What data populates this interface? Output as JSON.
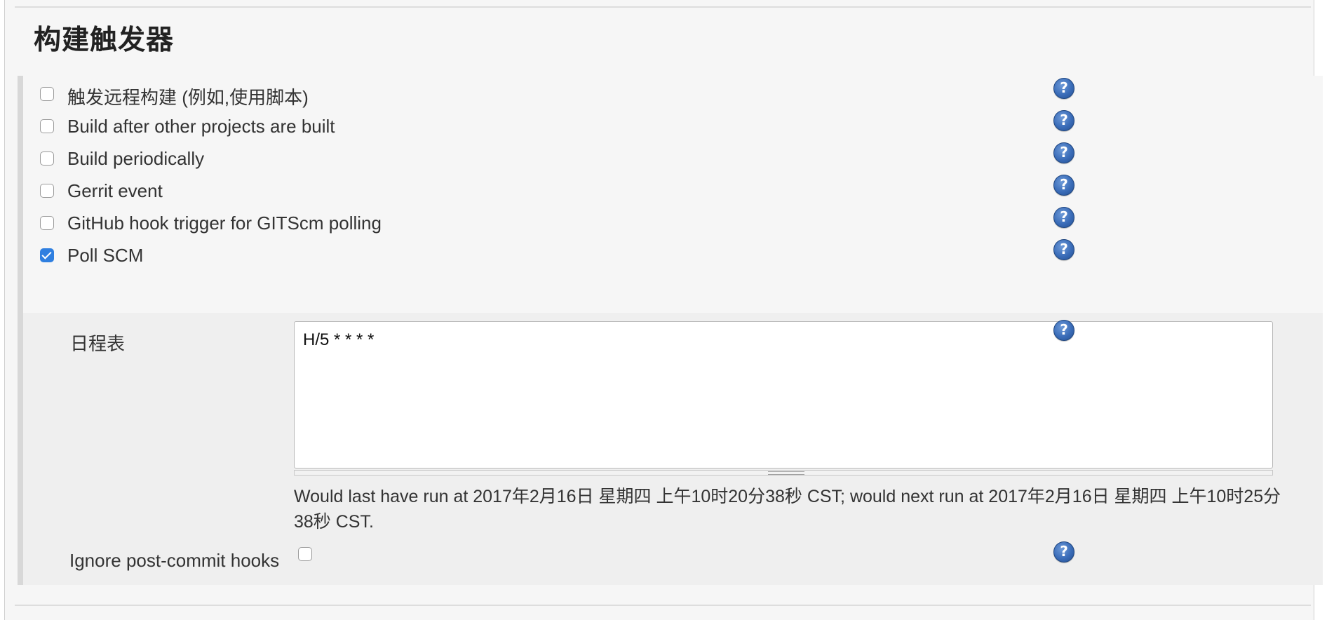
{
  "section": {
    "title": "构建触发器"
  },
  "triggers": [
    {
      "label": "触发远程构建 (例如,使用脚本)",
      "checked": false
    },
    {
      "label": "Build after other projects are built",
      "checked": false
    },
    {
      "label": "Build periodically",
      "checked": false
    },
    {
      "label": "Gerrit event",
      "checked": false
    },
    {
      "label": "GitHub hook trigger for GITScm polling",
      "checked": false
    },
    {
      "label": "Poll SCM",
      "checked": true
    }
  ],
  "poll_scm": {
    "schedule_label": "日程表",
    "schedule_value": "H/5 * * * *",
    "schedule_info": "Would last have run at 2017年2月16日 星期四 上午10时20分38秒 CST; would next run at 2017年2月16日 星期四 上午10时25分38秒 CST.",
    "ignore_hooks_label": "Ignore post-commit hooks",
    "ignore_hooks_checked": false
  },
  "help_icon_glyph": "?",
  "colors": {
    "checkbox_checked": "#2f7fe0",
    "help_icon": "#3a6cb8"
  }
}
